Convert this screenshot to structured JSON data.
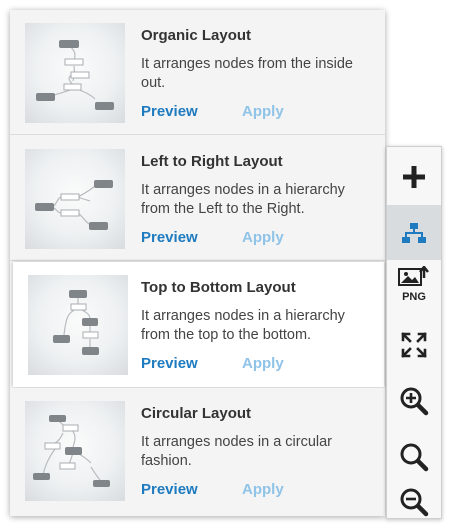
{
  "layouts": [
    {
      "title": "Organic Layout",
      "description": "It arranges nodes from the inside out.",
      "preview_label": "Preview",
      "apply_label": "Apply"
    },
    {
      "title": "Left to Right Layout",
      "description": "It arranges nodes in a hierarchy from the Left to the Right.",
      "preview_label": "Preview",
      "apply_label": "Apply"
    },
    {
      "title": "Top to Bottom Layout",
      "description": "It arranges nodes in a hierarchy from the top to the bottom.",
      "preview_label": "Preview",
      "apply_label": "Apply"
    },
    {
      "title": "Circular Layout",
      "description": "It arranges nodes in a circular fashion.",
      "preview_label": "Preview",
      "apply_label": "Apply"
    }
  ],
  "toolbar": {
    "tools": [
      {
        "icon": "plus-icon"
      },
      {
        "icon": "layout-hierarchy-icon",
        "active": true
      },
      {
        "icon": "export-png-icon",
        "label": "PNG"
      },
      {
        "icon": "fit-to-screen-icon"
      },
      {
        "icon": "zoom-in-icon"
      },
      {
        "icon": "zoom-reset-icon"
      },
      {
        "icon": "zoom-out-icon"
      }
    ]
  },
  "colors": {
    "link": "#1e7bbf",
    "link_light": "#8fc3e8",
    "active_tool_icon": "#1e7bbf",
    "node": "#7f8589"
  }
}
